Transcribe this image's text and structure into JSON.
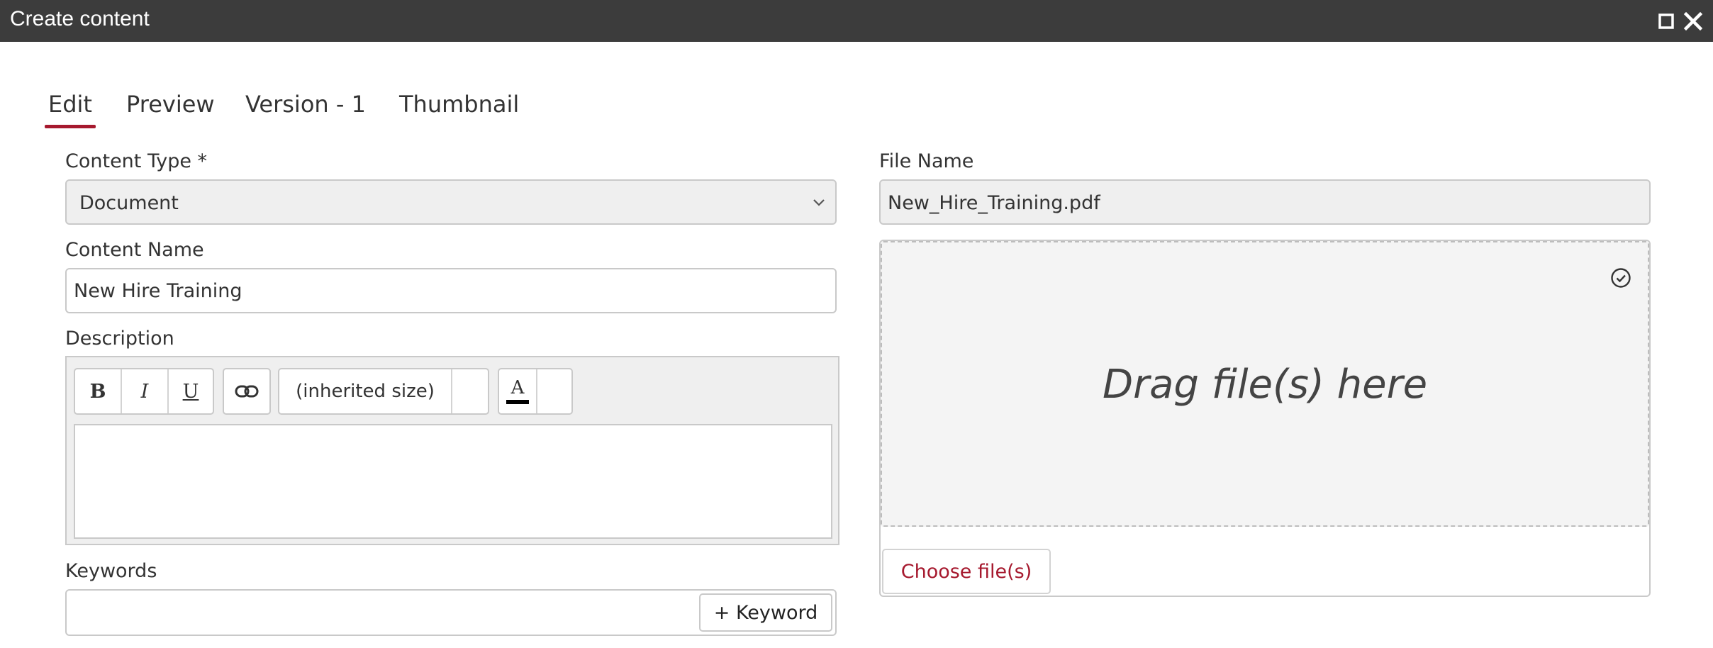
{
  "window": {
    "title": "Create content",
    "maximize_icon": "maximize-icon",
    "close_icon": "close-icon"
  },
  "tabs": [
    {
      "label": "Edit",
      "active": true
    },
    {
      "label": "Preview",
      "active": false
    },
    {
      "label": "Version - 1",
      "active": false
    },
    {
      "label": "Thumbnail",
      "active": false
    }
  ],
  "form": {
    "content_type": {
      "label": "Content Type *",
      "value": "Document"
    },
    "content_name": {
      "label": "Content Name",
      "value": "New Hire Training"
    },
    "description": {
      "label": "Description",
      "toolbar": {
        "bold": "B",
        "italic": "I",
        "underline": "U",
        "link_icon": "link-icon",
        "font_size": "(inherited size)",
        "font_color": "A"
      },
      "value": ""
    },
    "keywords": {
      "label": "Keywords",
      "add_button": "+ Keyword"
    }
  },
  "file": {
    "label": "File Name",
    "value": "New_Hire_Training.pdf",
    "dropzone_text": "Drag file(s) here",
    "check_icon": "check-circle-icon",
    "choose_button": "Choose file(s)"
  },
  "colors": {
    "accent": "#a6192e",
    "titlebar": "#3c3c3c",
    "field_bg": "#efefef",
    "border": "#c9c9c9"
  }
}
